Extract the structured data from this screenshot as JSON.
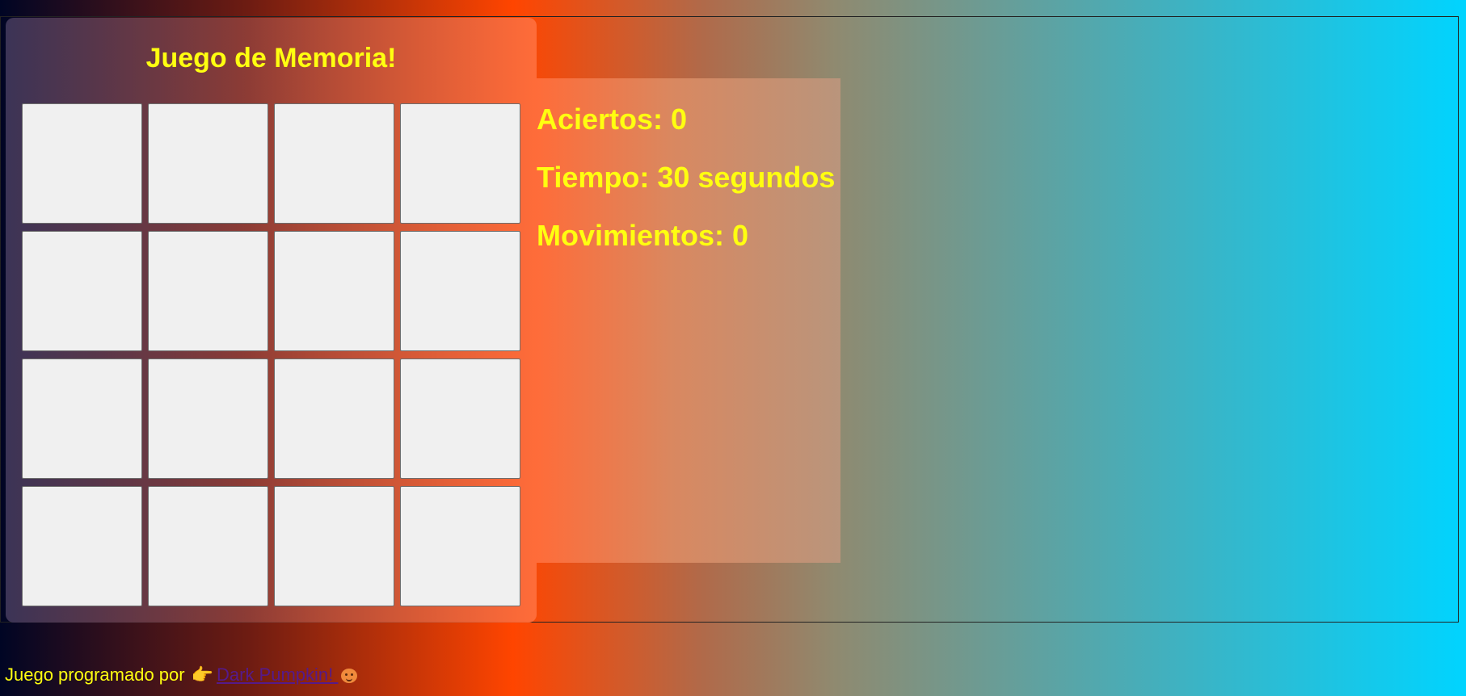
{
  "game": {
    "title": "Juego de Memoria!",
    "cards": [
      {
        "id": 1
      },
      {
        "id": 2
      },
      {
        "id": 3
      },
      {
        "id": 4
      },
      {
        "id": 5
      },
      {
        "id": 6
      },
      {
        "id": 7
      },
      {
        "id": 8
      },
      {
        "id": 9
      },
      {
        "id": 10
      },
      {
        "id": 11
      },
      {
        "id": 12
      },
      {
        "id": 13
      },
      {
        "id": 14
      },
      {
        "id": 15
      },
      {
        "id": 16
      }
    ]
  },
  "stats": {
    "aciertos": "Aciertos: 0",
    "tiempo": "Tiempo: 30 segundos",
    "movimientos": "Movimientos: 0"
  },
  "footer": {
    "text": "Juego programado por",
    "hand_icon": "👉",
    "link_text": "Dark Pumpkin!",
    "pumpkin_icon": "pumpkin-icon"
  },
  "colors": {
    "text_accent": "#ffff10",
    "card_face": "#f0f0f0",
    "link": "#551a8b"
  }
}
